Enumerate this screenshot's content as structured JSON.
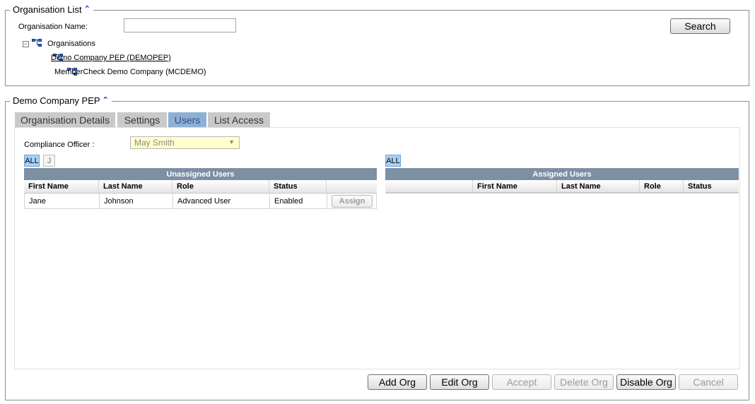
{
  "org_list": {
    "legend": "Organisation List",
    "name_label": "Organisation Name:",
    "name_value": "",
    "search_button": "Search",
    "tree": {
      "root_label": "Organisations",
      "items": [
        {
          "label": "Demo Company PEP (DEMOPEP)",
          "selected": true
        },
        {
          "label": "MemberCheck Demo Company (MCDEMO)",
          "selected": false
        }
      ]
    }
  },
  "detail": {
    "legend": "Demo Company PEP",
    "tabs": [
      "Organisation Details",
      "Settings",
      "Users",
      "List Access"
    ],
    "active_tab": "Users",
    "compliance_label": "Compliance Officer :",
    "compliance_value": "May Smith",
    "unassigned": {
      "filters": [
        "ALL",
        "J"
      ],
      "title": "Unassigned Users",
      "columns": [
        "First Name",
        "Last Name",
        "Role",
        "Status",
        ""
      ],
      "rows": [
        {
          "first": "Jane",
          "last": "Johnson",
          "role": "Advanced User",
          "status": "Enabled",
          "action": "Assign"
        }
      ]
    },
    "assigned": {
      "filters": [
        "ALL"
      ],
      "title": "Assigned Users",
      "columns": [
        "",
        "First Name",
        "Last Name",
        "Role",
        "Status"
      ],
      "rows": []
    },
    "buttons": {
      "add_org": "Add Org",
      "edit_org": "Edit Org",
      "accept": "Accept",
      "delete_org": "Delete Org",
      "disable_org": "Disable Org",
      "cancel": "Cancel"
    }
  },
  "colors": {
    "accent_tab": "#8fb0d6",
    "grid_title": "#7c8fa3",
    "select_bg": "#ffffcc",
    "filter_active": "#a9d1f5"
  }
}
